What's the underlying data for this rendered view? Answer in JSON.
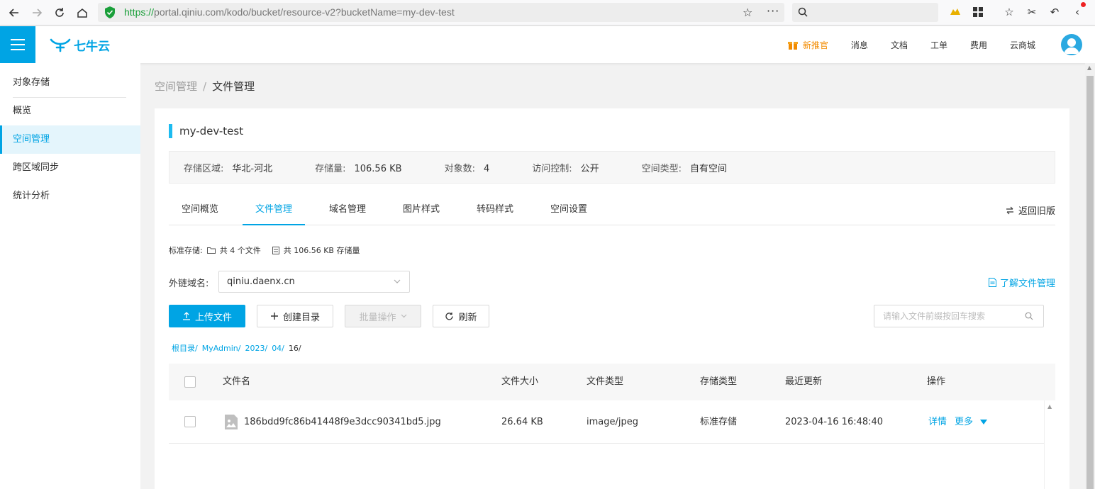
{
  "browser": {
    "url_scheme": "https://",
    "url_rest": "portal.qiniu.com/kodo/bucket/resource-v2?bucketName=my-dev-test"
  },
  "header": {
    "logo_text": "七牛云",
    "links": [
      {
        "label": "新推官",
        "highlight": true
      },
      {
        "label": "消息"
      },
      {
        "label": "文档"
      },
      {
        "label": "工单"
      },
      {
        "label": "费用"
      },
      {
        "label": "云商城"
      }
    ]
  },
  "sidebar": {
    "title": "对象存储",
    "items": [
      {
        "label": "概览"
      },
      {
        "label": "空间管理",
        "active": true
      },
      {
        "label": "跨区域同步"
      },
      {
        "label": "统计分析"
      }
    ]
  },
  "breadcrumb": {
    "parent": "空间管理",
    "separator": "/",
    "current": "文件管理"
  },
  "bucket": {
    "name": "my-dev-test",
    "info": [
      {
        "label": "存储区域:",
        "value": "华北-河北"
      },
      {
        "label": "存储量:",
        "value": "106.56 KB"
      },
      {
        "label": "对象数:",
        "value": "4"
      },
      {
        "label": "访问控制:",
        "value": "公开"
      },
      {
        "label": "空间类型:",
        "value": "自有空间"
      }
    ]
  },
  "tabs": [
    {
      "label": "空间概览"
    },
    {
      "label": "文件管理",
      "active": true
    },
    {
      "label": "域名管理"
    },
    {
      "label": "图片样式"
    },
    {
      "label": "转码样式"
    },
    {
      "label": "空间设置"
    }
  ],
  "old_version_label": "返回旧版",
  "stats": {
    "prefix": "标准存储:",
    "files": "共 4 个文件",
    "size": "共 106.56 KB 存储量"
  },
  "domain": {
    "label": "外链域名:",
    "value": "qiniu.daenx.cn"
  },
  "learn_link": "了解文件管理",
  "toolbar": {
    "upload": "上传文件",
    "mkdir": "创建目录",
    "batch": "批量操作",
    "refresh": "刷新",
    "search_placeholder": "请输入文件前缀按回车搜索"
  },
  "path": {
    "segments": [
      "根目录/",
      "MyAdmin/",
      "2023/",
      "04/"
    ],
    "current": "16/"
  },
  "table": {
    "columns": [
      "文件名",
      "文件大小",
      "文件类型",
      "存储类型",
      "最近更新",
      "操作"
    ],
    "rows": [
      {
        "name": "186bdd9fc86b41448f9e3dcc90341bd5.jpg",
        "size": "26.64 KB",
        "type": "image/jpeg",
        "storage": "标准存储",
        "updated": "2023-04-16 16:48:40",
        "action_detail": "详情",
        "action_more": "更多"
      }
    ]
  },
  "colors": {
    "accent": "#00a4e4",
    "highlight": "#f28b00"
  }
}
